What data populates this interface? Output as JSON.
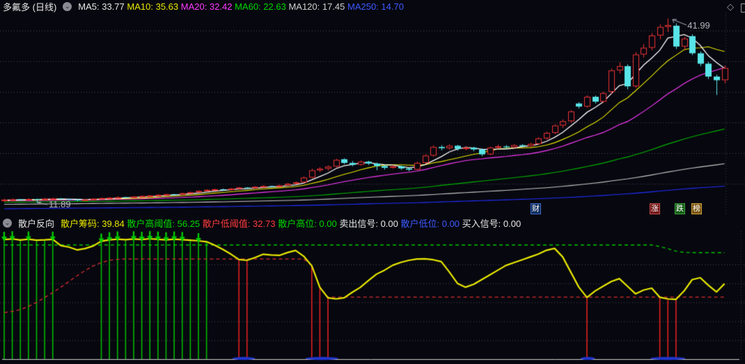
{
  "window": {
    "background": "#07070f"
  },
  "header": {
    "title": "多氟多 (日线)",
    "collapse_icon": "chevron-down-circle",
    "corner_icons": [
      "dotted-diamond",
      "window-corner"
    ],
    "ma_items": [
      {
        "text": "MA5: 33.77",
        "color": "#e8e8e8"
      },
      {
        "text": "MA10: 35.63",
        "color": "#e8e800"
      },
      {
        "text": "MA20: 32.42",
        "color": "#ff3cff"
      },
      {
        "text": "MA60: 22.63",
        "color": "#00d800"
      },
      {
        "text": "MA120: 17.45",
        "color": "#d0d0d0"
      },
      {
        "text": "MA250: 14.70",
        "color": "#3c5aff"
      }
    ]
  },
  "badges": [
    {
      "key": "cai",
      "label": "财"
    },
    {
      "key": "zhang",
      "label": "涨"
    },
    {
      "key": "die",
      "label": "跌"
    },
    {
      "key": "bang",
      "label": "榜"
    }
  ],
  "indicator_header": {
    "collapse_icon": "chevron-down-circle",
    "title": "散户反向",
    "fields": [
      {
        "text": "散户筹码: 39.84",
        "color": "#e8e800"
      },
      {
        "text": "散户高阈值: 56.25",
        "color": "#00d800"
      },
      {
        "text": "散户低阈值: 32.73",
        "color": "#ff3c3c"
      },
      {
        "text": "散户高位: 0.00",
        "color": "#00d800"
      },
      {
        "text": "卖出信号: 0.00",
        "color": "#e8e8e8"
      },
      {
        "text": "散户低位: 0.00",
        "color": "#3c5aff"
      },
      {
        "text": "买入信号: 0.00",
        "color": "#e8e8e8"
      }
    ]
  },
  "chart_data": [
    {
      "type": "candlestick",
      "title": "多氟多 日线 price pane",
      "ylim": [
        11.5,
        43.5
      ],
      "grid_y": [
        15,
        20,
        25,
        30,
        35,
        40
      ],
      "grid_x_vertical": [
        1042
      ],
      "up_color": "#ee3434",
      "down_color": "#58e5e8",
      "annotations": [
        {
          "id": "high",
          "text": "41.99",
          "index": 82,
          "price": 41.99
        },
        {
          "id": "low",
          "text": "11.89",
          "index": 4,
          "price": 11.89
        }
      ],
      "ma_periods": [
        5,
        10,
        20,
        60,
        120,
        250
      ],
      "ma_colors": [
        "#ffffff",
        "#e8e800",
        "#ff3cff",
        "#00b400",
        "#c8c8c8",
        "#2030ff"
      ],
      "prehistory": {
        "days": 250,
        "start_price": 9.5,
        "end_price": 12.3
      },
      "candles": [
        [
          12.3,
          12.55,
          12.1,
          12.4
        ],
        [
          12.4,
          12.6,
          12.28,
          12.45
        ],
        [
          12.45,
          12.52,
          12.2,
          12.35
        ],
        [
          12.35,
          12.62,
          12.3,
          12.5
        ],
        [
          12.5,
          12.58,
          11.89,
          12.42
        ],
        [
          12.42,
          12.68,
          12.38,
          12.55
        ],
        [
          12.55,
          12.72,
          12.45,
          12.6
        ],
        [
          12.6,
          12.66,
          12.38,
          12.48
        ],
        [
          12.48,
          12.55,
          12.25,
          12.38
        ],
        [
          12.38,
          12.48,
          12.15,
          12.3
        ],
        [
          12.3,
          12.52,
          12.24,
          12.42
        ],
        [
          12.42,
          12.65,
          12.36,
          12.55
        ],
        [
          12.55,
          12.75,
          12.48,
          12.65
        ],
        [
          12.65,
          12.82,
          12.55,
          12.72
        ],
        [
          12.72,
          12.92,
          12.62,
          12.8
        ],
        [
          12.8,
          12.86,
          12.6,
          12.74
        ],
        [
          12.74,
          13.0,
          12.68,
          12.9
        ],
        [
          12.9,
          13.1,
          12.8,
          13.0
        ],
        [
          13.0,
          13.18,
          12.9,
          13.08
        ],
        [
          13.08,
          13.3,
          13.0,
          13.18
        ],
        [
          13.18,
          13.38,
          13.08,
          13.28
        ],
        [
          13.28,
          13.35,
          13.1,
          13.24
        ],
        [
          13.24,
          13.55,
          13.18,
          13.45
        ],
        [
          13.45,
          13.7,
          13.35,
          13.6
        ],
        [
          13.6,
          13.95,
          13.52,
          13.82
        ],
        [
          13.82,
          14.1,
          13.7,
          14.0
        ],
        [
          14.0,
          14.22,
          13.88,
          14.1
        ],
        [
          14.1,
          14.18,
          13.85,
          13.98
        ],
        [
          13.98,
          14.3,
          13.9,
          14.2
        ],
        [
          14.2,
          14.5,
          14.1,
          14.38
        ],
        [
          14.38,
          14.45,
          14.15,
          14.3
        ],
        [
          14.3,
          14.62,
          14.22,
          14.5
        ],
        [
          14.5,
          14.75,
          14.4,
          14.62
        ],
        [
          14.62,
          14.7,
          14.4,
          14.55
        ],
        [
          14.55,
          14.85,
          14.45,
          14.72
        ],
        [
          14.72,
          15.12,
          14.62,
          15.0
        ],
        [
          15.0,
          15.35,
          14.9,
          15.22
        ],
        [
          15.22,
          16.2,
          15.1,
          16.0
        ],
        [
          16.0,
          17.45,
          15.85,
          17.2
        ],
        [
          17.2,
          17.7,
          16.9,
          17.45
        ],
        [
          17.45,
          18.0,
          17.15,
          17.8
        ],
        [
          17.8,
          19.1,
          17.6,
          18.9
        ],
        [
          19.0,
          19.15,
          18.2,
          18.4
        ],
        [
          18.4,
          18.7,
          17.85,
          18.1
        ],
        [
          18.1,
          18.8,
          17.95,
          18.6
        ],
        [
          18.6,
          18.75,
          18.05,
          18.3
        ],
        [
          18.3,
          18.45,
          17.2,
          17.9
        ],
        [
          17.9,
          18.1,
          17.3,
          17.6
        ],
        [
          17.6,
          18.05,
          17.45,
          17.85
        ],
        [
          17.85,
          17.95,
          17.25,
          17.5
        ],
        [
          17.5,
          17.65,
          17.05,
          17.3
        ],
        [
          17.3,
          18.6,
          17.2,
          18.4
        ],
        [
          18.4,
          19.8,
          18.25,
          19.6
        ],
        [
          19.6,
          21.25,
          19.4,
          21.0
        ],
        [
          21.0,
          21.3,
          20.45,
          20.8
        ],
        [
          20.8,
          21.45,
          20.55,
          21.2
        ],
        [
          21.2,
          21.35,
          20.4,
          20.7
        ],
        [
          20.7,
          21.15,
          20.45,
          20.9
        ],
        [
          20.9,
          21.05,
          20.3,
          20.6
        ],
        [
          20.6,
          20.75,
          19.5,
          19.8
        ],
        [
          19.8,
          21.05,
          19.65,
          20.9
        ],
        [
          20.9,
          21.4,
          20.7,
          21.1
        ],
        [
          21.1,
          21.3,
          20.7,
          20.95
        ],
        [
          20.95,
          21.5,
          20.8,
          21.3
        ],
        [
          21.3,
          21.45,
          20.9,
          21.15
        ],
        [
          21.15,
          21.7,
          21.0,
          21.5
        ],
        [
          21.5,
          22.6,
          21.35,
          22.4
        ],
        [
          22.4,
          23.5,
          22.2,
          23.3
        ],
        [
          23.3,
          24.7,
          23.1,
          24.5
        ],
        [
          24.5,
          25.5,
          24.1,
          25.2
        ],
        [
          25.2,
          27.0,
          24.95,
          26.8
        ],
        [
          28.1,
          28.3,
          27.3,
          27.6
        ],
        [
          27.6,
          29.45,
          27.4,
          29.2
        ],
        [
          29.2,
          29.4,
          28.1,
          28.4
        ],
        [
          28.4,
          30.05,
          28.2,
          29.8
        ],
        [
          30.0,
          33.8,
          29.6,
          33.5
        ],
        [
          33.5,
          34.8,
          33.0,
          34.2
        ],
        [
          34.2,
          34.5,
          30.4,
          30.9
        ],
        [
          30.9,
          36.5,
          30.6,
          36.1
        ],
        [
          36.1,
          37.8,
          35.6,
          37.2
        ],
        [
          37.2,
          39.6,
          36.8,
          39.2
        ],
        [
          39.2,
          41.0,
          38.6,
          40.6
        ],
        [
          40.6,
          41.99,
          39.8,
          40.9
        ],
        [
          40.8,
          41.2,
          37.0,
          37.4
        ],
        [
          37.4,
          39.0,
          36.9,
          38.7
        ],
        [
          39.1,
          39.4,
          36.0,
          36.3
        ],
        [
          36.3,
          36.6,
          34.2,
          34.6
        ],
        [
          34.6,
          34.9,
          32.1,
          32.5
        ],
        [
          32.5,
          32.8,
          29.5,
          31.9
        ],
        [
          31.9,
          34.3,
          31.4,
          33.9
        ]
      ]
    },
    {
      "type": "line",
      "title": "散户反向 indicator pane",
      "ylim": [
        0,
        68
      ],
      "grid_y": [
        10,
        20,
        30,
        40,
        50
      ],
      "grid_x_vertical": [
        1064
      ],
      "zero_line_value": 0,
      "series": [
        {
          "name": "散户筹码",
          "color": "#e8e800",
          "style": "solid",
          "values": [
            63.2,
            63.5,
            62.9,
            63.4,
            62.8,
            63.0,
            63.3,
            60.0,
            59.2,
            57.7,
            58.4,
            59.8,
            62.3,
            63.0,
            63.4,
            63.1,
            63.5,
            63.2,
            63.6,
            63.3,
            63.0,
            63.4,
            63.1,
            62.8,
            62.5,
            62.0,
            60.2,
            58.0,
            55.5,
            52.6,
            52.2,
            53.7,
            55.4,
            55.0,
            54.8,
            56.3,
            57.4,
            54.4,
            49.3,
            37.9,
            32.4,
            31.8,
            32.4,
            35.3,
            37.9,
            41.5,
            44.9,
            47.0,
            49.6,
            51.1,
            52.2,
            52.9,
            53.0,
            52.5,
            51.5,
            46.0,
            40.0,
            38.0,
            39.5,
            42.0,
            44.5,
            47.0,
            49.5,
            51.0,
            52.5,
            54.0,
            55.5,
            57.5,
            58.5,
            54.0,
            46.0,
            38.0,
            32.6,
            36.0,
            38.5,
            41.0,
            42.5,
            38.5,
            34.5,
            36.5,
            37.5,
            32.7,
            31.8,
            31.6,
            36.0,
            42.0,
            43.0,
            39.0,
            35.5,
            39.84
          ]
        },
        {
          "name": "散户高阈值",
          "color": "#00c800",
          "style": "dashed",
          "values": [
            60.3,
            60.3,
            60.3,
            60.3,
            60.3,
            60.3,
            60.3,
            60.3,
            60.3,
            60.3,
            60.3,
            60.3,
            60.3,
            60.3,
            60.3,
            60.3,
            60.3,
            60.3,
            60.3,
            60.3,
            60.3,
            60.3,
            60.3,
            60.3,
            60.3,
            60.3,
            60.3,
            60.3,
            60.3,
            60.3,
            60.3,
            60.3,
            60.3,
            60.3,
            60.3,
            60.3,
            60.3,
            60.3,
            60.3,
            60.3,
            60.3,
            60.3,
            60.3,
            60.3,
            60.3,
            60.3,
            60.3,
            60.3,
            60.3,
            60.3,
            60.3,
            60.3,
            60.3,
            60.3,
            60.3,
            60.3,
            60.3,
            60.3,
            60.3,
            60.3,
            60.3,
            60.3,
            60.3,
            60.3,
            60.3,
            60.3,
            60.3,
            60.3,
            60.3,
            60.3,
            60.3,
            60.3,
            60.3,
            60.3,
            60.3,
            60.3,
            60.3,
            60.3,
            60.3,
            60.3,
            60.3,
            59.5,
            58.3,
            57.0,
            56.4,
            56.25,
            56.25,
            56.25,
            56.25,
            56.25
          ]
        },
        {
          "name": "散户低阈值",
          "color": "#e03030",
          "style": "dashed",
          "values": [
            24.6,
            25.2,
            26.2,
            27.8,
            30.0,
            32.5,
            35.2,
            38.0,
            41.0,
            44.0,
            46.8,
            49.2,
            51.0,
            52.2,
            52.7,
            52.9,
            52.9,
            52.9,
            52.9,
            52.9,
            52.9,
            52.9,
            52.9,
            52.9,
            52.9,
            52.9,
            52.9,
            52.9,
            52.9,
            52.9,
            52.9,
            52.9,
            52.9,
            52.9,
            52.9,
            52.9,
            52.9,
            52.9,
            49.5,
            38.1,
            32.73,
            32.73,
            32.73,
            32.73,
            32.73,
            32.73,
            32.73,
            32.73,
            32.73,
            32.73,
            32.73,
            32.73,
            32.73,
            32.73,
            32.73,
            32.73,
            32.73,
            32.73,
            32.73,
            32.73,
            32.73,
            32.73,
            32.73,
            32.73,
            32.73,
            32.73,
            32.73,
            32.73,
            32.73,
            32.73,
            32.73,
            32.73,
            32.73,
            32.73,
            32.73,
            32.73,
            32.73,
            32.73,
            32.73,
            32.73,
            32.73,
            32.73,
            32.73,
            32.73,
            32.73,
            32.73,
            32.73,
            32.73,
            32.73,
            32.73
          ]
        }
      ],
      "sell_bars_color": "#00bb00",
      "sell_bars": [
        0,
        1,
        2,
        3,
        4,
        5,
        6,
        12,
        13,
        14,
        15,
        16,
        17,
        18,
        19,
        20,
        21,
        22,
        23,
        24,
        25
      ],
      "sell_arrows": [
        0,
        1,
        3,
        6,
        12,
        13,
        14,
        16,
        17,
        18,
        19,
        20,
        21,
        22,
        24
      ],
      "buy_bars_color": "#e02020",
      "buy_bars": [
        29,
        30,
        38,
        39,
        40,
        72,
        81,
        82,
        83
      ],
      "buy_marks_color": "#2034cc",
      "buy_marks_spans": [
        [
          28.2,
          31.0
        ],
        [
          37.2,
          41.3
        ],
        [
          71.2,
          73.0
        ],
        [
          79.8,
          84.2
        ]
      ]
    }
  ]
}
